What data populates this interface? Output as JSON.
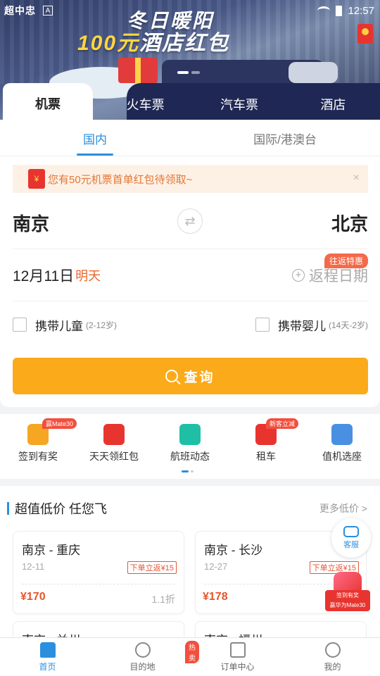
{
  "status_bar": {
    "left_text": "超中忠",
    "app_indicator": "A",
    "time": "12:57"
  },
  "banner": {
    "title_line1": "冬日暖阳",
    "title_line2_num": "100元",
    "title_line2_rest": "酒店红包"
  },
  "category_tabs": [
    {
      "label": "机票",
      "active": true
    },
    {
      "label": "火车票",
      "active": false
    },
    {
      "label": "汽车票",
      "active": false
    },
    {
      "label": "酒店",
      "active": false
    }
  ],
  "region_tabs": [
    {
      "label": "国内",
      "active": true
    },
    {
      "label": "国际/港澳台",
      "active": false
    }
  ],
  "notice": {
    "icon_text": "¥",
    "text": "您有50元机票首单红包待领取~",
    "close": "×"
  },
  "route": {
    "from": "南京",
    "to": "北京",
    "swap_glyph": "⇄"
  },
  "dates": {
    "depart": "12月11日",
    "depart_relative": "明天",
    "return_placeholder": "返程日期",
    "return_plus": "+",
    "roundtrip_badge": "往返特惠"
  },
  "options": {
    "child": {
      "label": "携带儿童",
      "note": "(2-12岁)"
    },
    "infant": {
      "label": "携带婴儿",
      "note": "(14天-2岁)"
    }
  },
  "search_button": "查询",
  "quick_entries": [
    {
      "label": "签到有奖",
      "badge": "赢Mate30",
      "color": "#f5a623"
    },
    {
      "label": "天天领红包",
      "badge": "",
      "color": "#e8342f"
    },
    {
      "label": "航班动态",
      "badge": "",
      "color": "#1fbfa6"
    },
    {
      "label": "租车",
      "badge": "新客立减",
      "color": "#e8342f"
    },
    {
      "label": "值机选座",
      "badge": "",
      "color": "#4a90e2"
    }
  ],
  "deals": {
    "title": "超值低价 任您飞",
    "more": "更多低价 >",
    "items": [
      {
        "route": "南京 - 重庆",
        "date": "12-11",
        "tag": "下单立返¥15",
        "price": "¥170",
        "discount": "1.1折"
      },
      {
        "route": "南京 - 长沙",
        "date": "12-27",
        "tag": "下单立返¥15",
        "price": "¥178",
        "discount": ""
      },
      {
        "route": "南京 - 兰州",
        "date": "",
        "tag": "",
        "price": "",
        "discount": ""
      },
      {
        "route": "南京 - 福州",
        "date": "",
        "tag": "",
        "price": "",
        "discount": ""
      }
    ]
  },
  "service_button": "客服",
  "promo": {
    "line1": "签到有奖",
    "line2": "赢华为Mate30"
  },
  "bottom_nav": [
    {
      "label": "首页",
      "active": true,
      "badge": ""
    },
    {
      "label": "目的地",
      "active": false,
      "badge": "热卖"
    },
    {
      "label": "订单中心",
      "active": false,
      "badge": ""
    },
    {
      "label": "我的",
      "active": false,
      "badge": ""
    }
  ]
}
